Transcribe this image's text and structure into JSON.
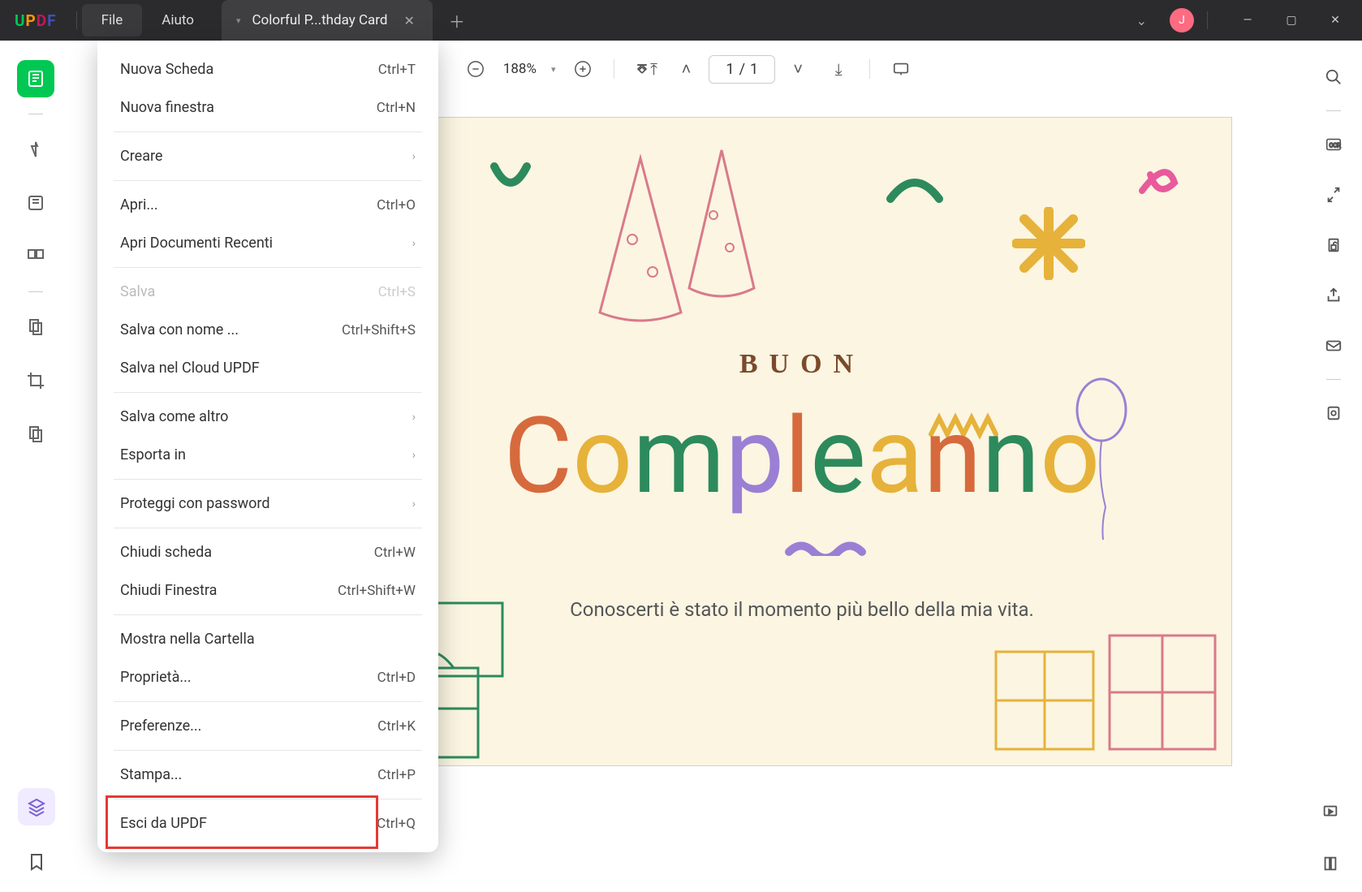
{
  "app": {
    "logo_u": "U",
    "logo_p": "P",
    "logo_d": "D",
    "logo_f": "F"
  },
  "menubar": {
    "file": "File",
    "help": "Aiuto"
  },
  "tab": {
    "title": "Colorful P...thday Card"
  },
  "avatar": {
    "initial": "J"
  },
  "toolbar": {
    "zoom": "188%",
    "page_current": "1",
    "page_sep": "/",
    "page_total": "1"
  },
  "filemenu": {
    "new_tab": "Nuova Scheda",
    "new_tab_sc": "Ctrl+T",
    "new_window": "Nuova finestra",
    "new_window_sc": "Ctrl+N",
    "create": "Creare",
    "open": "Apri...",
    "open_sc": "Ctrl+O",
    "open_recent": "Apri Documenti Recenti",
    "save": "Salva",
    "save_sc": "Ctrl+S",
    "save_as": "Salva con nome ...",
    "save_as_sc": "Ctrl+Shift+S",
    "save_cloud": "Salva nel Cloud UPDF",
    "save_other": "Salva come altro",
    "export": "Esporta in",
    "protect": "Proteggi con password",
    "close_tab": "Chiudi scheda",
    "close_tab_sc": "Ctrl+W",
    "close_window": "Chiudi Finestra",
    "close_window_sc": "Ctrl+Shift+W",
    "show_folder": "Mostra nella Cartella",
    "properties": "Proprietà...",
    "properties_sc": "Ctrl+D",
    "preferences": "Preferenze...",
    "preferences_sc": "Ctrl+K",
    "print": "Stampa...",
    "print_sc": "Ctrl+P",
    "exit": "Esci da UPDF",
    "exit_sc": "Ctrl+Q"
  },
  "card": {
    "buon": "BUON",
    "message": "Conoscerti è stato il momento più bello della mia vita."
  }
}
